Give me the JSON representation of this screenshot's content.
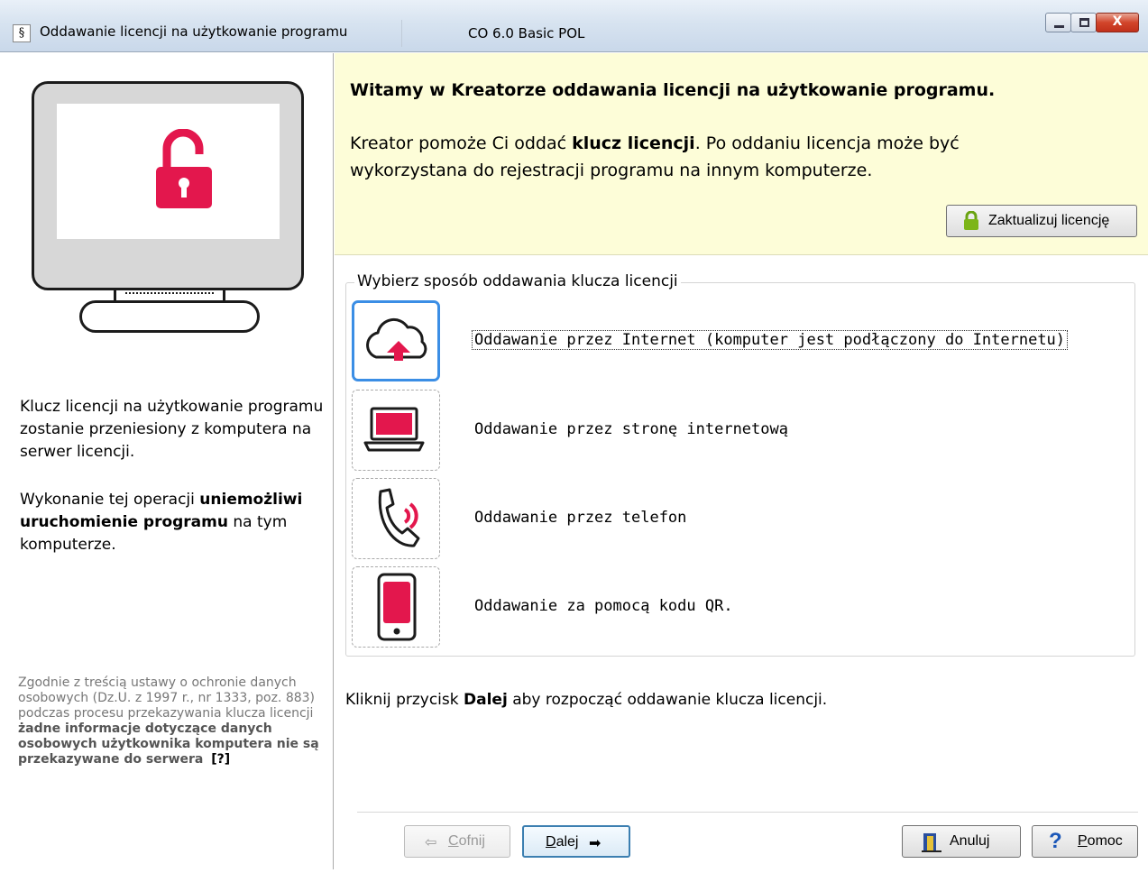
{
  "window": {
    "icon_glyph": "§",
    "title": "Oddawanie licencji na użytkowanie programu",
    "subtitle": "CO 6.0 Basic POL",
    "minimize_icon": "minimize-icon",
    "maximize_icon": "maximize-icon",
    "close_glyph": "X"
  },
  "left": {
    "p1": "Klucz licencji na użytkowanie programu zostanie przeniesiony z komputera na serwer licencji.",
    "p2_pre": "Wykonanie tej operacji ",
    "p2_bold": "uniemożliwi uruchomienie programu",
    "p2_post": " na tym komputerze.",
    "legal_pre": "Zgodnie z treścią ustawy o ochronie danych osobowych (Dz.U. z 1997 r., nr 1333, poz. 883) podczas procesu przekazywania klucza licencji ",
    "legal_bold": "żadne informacje dotyczące danych osobowych użytkownika komputera nie są przekazywane do serwera",
    "legal_link": "[?]"
  },
  "welcome": {
    "heading": "Witamy w Kreatorze oddawania licencji na użytkowanie programu.",
    "text_pre": "Kreator pomoże Ci oddać ",
    "text_bold": "klucz licencji",
    "text_post": ". Po oddaniu licencja może być wykorzystana do rejestracji programu na innym komputerze.",
    "update_button": "Zaktualizuj licencję"
  },
  "options": {
    "group_title": "Wybierz sposób oddawania klucza licencji",
    "items": [
      {
        "label": "Oddawanie przez Internet (komputer jest podłączony do Internetu)",
        "icon": "cloud-upload-icon",
        "selected": true
      },
      {
        "label": "Oddawanie przez stronę internetową",
        "icon": "laptop-icon",
        "selected": false
      },
      {
        "label": "Oddawanie przez telefon",
        "icon": "phone-icon",
        "selected": false
      },
      {
        "label": "Oddawanie za pomocą kodu QR.",
        "icon": "smartphone-icon",
        "selected": false
      }
    ]
  },
  "hint": {
    "pre": "Kliknij przycisk ",
    "bold": "Dalej",
    "post": " aby rozpocząć oddawanie klucza licencji."
  },
  "buttons": {
    "back_underlined": "C",
    "back_rest": "ofnij",
    "next_underlined": "D",
    "next_rest": "alej",
    "cancel": "Anuluj",
    "help_underlined": "P",
    "help_rest": "omoc",
    "help_glyph": "?"
  },
  "colors": {
    "accent_red": "#e3174d",
    "welcome_bg": "#fdfdd8",
    "selection_blue": "#3b8ee5",
    "lock_green": "#7cb518"
  }
}
